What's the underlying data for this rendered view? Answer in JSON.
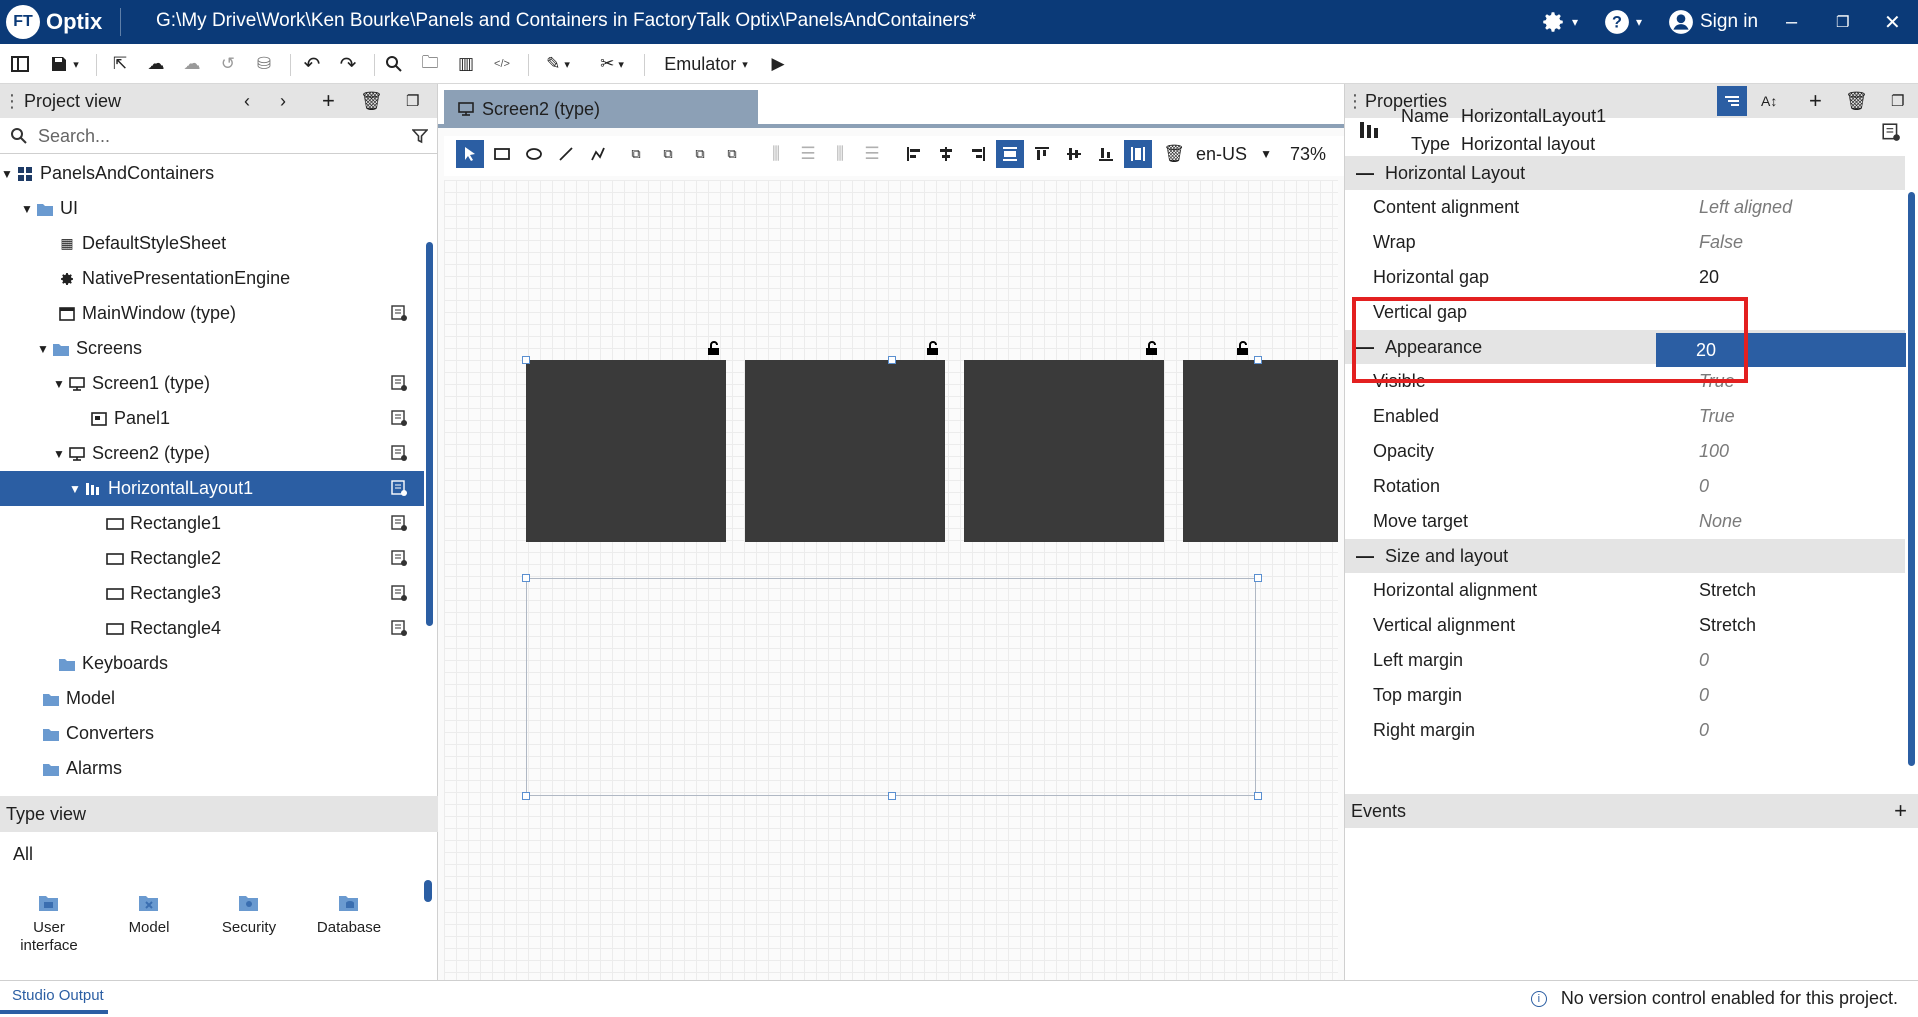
{
  "window": {
    "logo_badge": "FT",
    "logo_text": "Optix",
    "title": "G:\\My Drive\\Work\\Ken Bourke\\Panels and Containers in FactoryTalk Optix\\PanelsAndContainers*",
    "sign_in": "Sign in"
  },
  "toolbar": {
    "emulator_label": "Emulator"
  },
  "project_view": {
    "title": "Project view",
    "search_placeholder": "Search...",
    "tree": [
      {
        "label": "PanelsAndContainers"
      },
      {
        "label": "UI"
      },
      {
        "label": "DefaultStyleSheet"
      },
      {
        "label": "NativePresentationEngine"
      },
      {
        "label": "MainWindow (type)"
      },
      {
        "label": "Screens"
      },
      {
        "label": "Screen1 (type)"
      },
      {
        "label": "Panel1"
      },
      {
        "label": "Screen2 (type)"
      },
      {
        "label": "HorizontalLayout1"
      },
      {
        "label": "Rectangle1"
      },
      {
        "label": "Rectangle2"
      },
      {
        "label": "Rectangle3"
      },
      {
        "label": "Rectangle4"
      },
      {
        "label": "Keyboards"
      },
      {
        "label": "Model"
      },
      {
        "label": "Converters"
      },
      {
        "label": "Alarms"
      }
    ]
  },
  "type_view": {
    "title": "Type view",
    "filter": "All",
    "items": [
      {
        "label": "User interface"
      },
      {
        "label": "Model"
      },
      {
        "label": "Security"
      },
      {
        "label": "Database"
      }
    ]
  },
  "editor": {
    "tab_label": "Screen2 (type)",
    "locale": "en-US",
    "zoom": "73%"
  },
  "properties": {
    "title": "Properties",
    "name_label": "Name",
    "name_value": "HorizontalLayout1",
    "type_label": "Type",
    "type_value": "Horizontal layout",
    "sections": {
      "horizontal_layout": "Horizontal Layout",
      "appearance": "Appearance",
      "size_layout": "Size and layout",
      "events": "Events"
    },
    "horizontal_layout_rows": [
      {
        "label": "Content alignment",
        "value": "Left aligned"
      },
      {
        "label": "Wrap",
        "value": "False"
      },
      {
        "label": "Horizontal gap",
        "value": "20"
      },
      {
        "label": "Vertical gap",
        "value": "20"
      }
    ],
    "appearance_rows": [
      {
        "label": "Visible",
        "value": "True"
      },
      {
        "label": "Enabled",
        "value": "True"
      },
      {
        "label": "Opacity",
        "value": "100"
      },
      {
        "label": "Rotation",
        "value": "0"
      },
      {
        "label": "Move target",
        "value": "None"
      }
    ],
    "size_rows": [
      {
        "label": "Horizontal alignment",
        "value": "Stretch"
      },
      {
        "label": "Vertical alignment",
        "value": "Stretch"
      },
      {
        "label": "Left margin",
        "value": "0"
      },
      {
        "label": "Top margin",
        "value": "0"
      },
      {
        "label": "Right margin",
        "value": "0"
      }
    ]
  },
  "status": {
    "output_tab": "Studio Output",
    "message": "No version control enabled for this project."
  },
  "colors": {
    "brand_blue": "#0b3a78",
    "selection_blue": "#2b5ea3",
    "highlight_red": "#e32020",
    "shape_fill": "#3a3a3a"
  }
}
